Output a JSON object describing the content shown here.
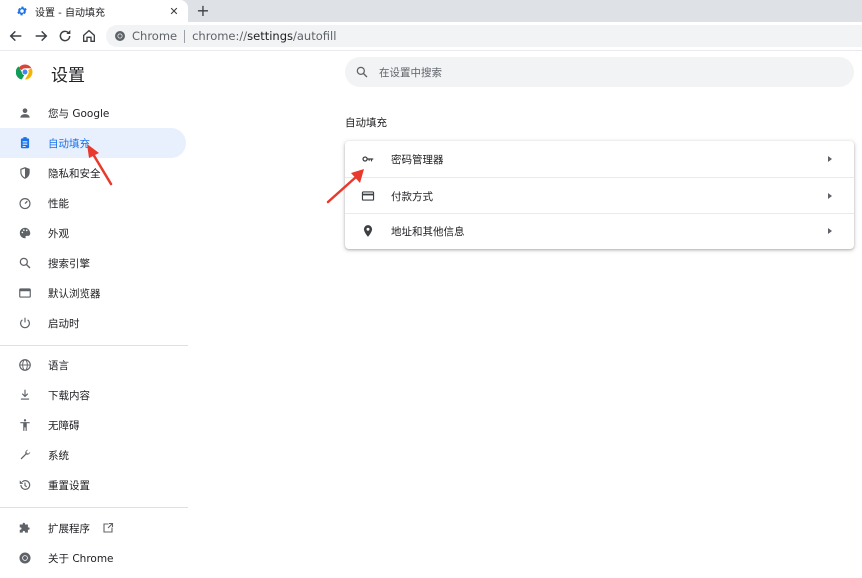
{
  "tab": {
    "title": "设置 - 自动填充",
    "close": "✕",
    "new_tab": "+"
  },
  "omnibox": {
    "site_chip": "Chrome",
    "url_prefix": "chrome://",
    "url_host": "settings",
    "url_path": "/autofill"
  },
  "app_title": "设置",
  "search": {
    "placeholder": "在设置中搜索"
  },
  "sidebar": {
    "items": [
      {
        "label": "您与 Google",
        "icon": "person-icon"
      },
      {
        "label": "自动填充",
        "icon": "clipboard-icon",
        "active": true
      },
      {
        "label": "隐私和安全",
        "icon": "shield-icon"
      },
      {
        "label": "性能",
        "icon": "speedometer-icon"
      },
      {
        "label": "外观",
        "icon": "palette-icon"
      },
      {
        "label": "搜索引擎",
        "icon": "search-icon"
      },
      {
        "label": "默认浏览器",
        "icon": "browser-window-icon"
      },
      {
        "label": "启动时",
        "icon": "power-icon"
      },
      {
        "label": "语言",
        "icon": "globe-icon"
      },
      {
        "label": "下载内容",
        "icon": "download-icon"
      },
      {
        "label": "无障碍",
        "icon": "accessibility-icon"
      },
      {
        "label": "系统",
        "icon": "wrench-icon"
      },
      {
        "label": "重置设置",
        "icon": "history-icon"
      },
      {
        "label": "扩展程序",
        "icon": "puzzle-icon"
      },
      {
        "label": "关于 Chrome",
        "icon": "chrome-icon"
      }
    ]
  },
  "section_title": "自动填充",
  "autofill_rows": [
    {
      "label": "密码管理器",
      "icon": "key-icon"
    },
    {
      "label": "付款方式",
      "icon": "credit-card-icon"
    },
    {
      "label": "地址和其他信息",
      "icon": "location-pin-icon"
    }
  ],
  "colors": {
    "accent": "#1a73e8",
    "active_bg": "#e8f0fe",
    "annotation": "#e8392c"
  }
}
